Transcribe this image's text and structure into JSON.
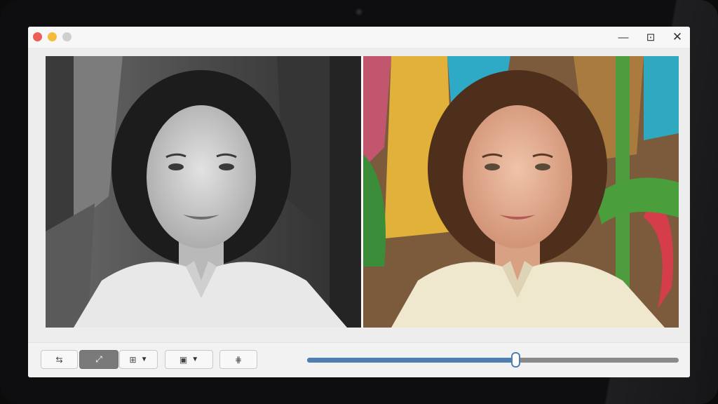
{
  "window": {
    "traffic_lights": [
      "close",
      "minimize",
      "zoom-disabled"
    ],
    "controls": {
      "minimize_glyph": "—",
      "maximize_glyph": "⊡",
      "close_glyph": "✕"
    }
  },
  "comparison": {
    "before_image": "black-and-white portrait of a young woman with curly dark hair in a light embroidered blouse",
    "after_image": "colorized portrait of the same young woman against a colorful painted background"
  },
  "toolbar": {
    "buttons": [
      {
        "icon": "adjust-sliders-icon",
        "glyph": "⇆"
      },
      {
        "icon": "fit-expand-icon",
        "glyph": "⤢",
        "active": true
      },
      {
        "icon": "layout-menu-icon",
        "glyph": "⊞",
        "dropdown": true
      },
      {
        "icon": "view-mode-menu-icon",
        "glyph": "▣",
        "dropdown": true
      },
      {
        "icon": "split-compare-icon",
        "glyph": "⋕"
      }
    ],
    "caret": "▼",
    "slider": {
      "fraction": 0.56
    }
  },
  "colors": {
    "accent": "#4f7fb0",
    "active_button": "#7a7a7a"
  }
}
